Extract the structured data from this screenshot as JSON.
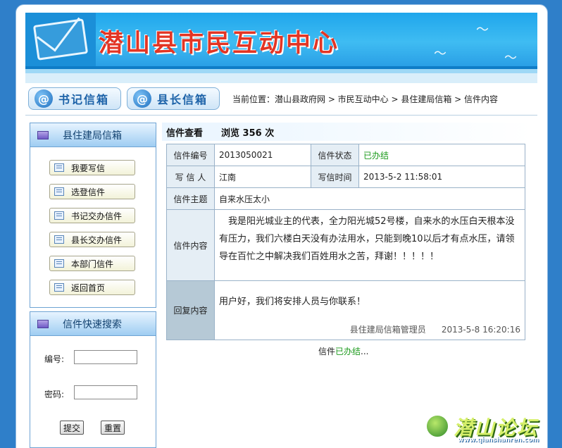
{
  "banner": {
    "title": "潜山县市民互动中心"
  },
  "nav": {
    "tabs": [
      {
        "label": "书记信箱"
      },
      {
        "label": "县长信箱"
      }
    ],
    "breadcrumb": "当前位置：潜山县政府网 > 市民互动中心 > 县住建局信箱 > 信件内容"
  },
  "sidebar": {
    "menu_title": "县住建局信箱",
    "items": [
      {
        "label": "我要写信"
      },
      {
        "label": "选登信件"
      },
      {
        "label": "书记交办信件"
      },
      {
        "label": "县长交办信件"
      },
      {
        "label": "本部门信件"
      },
      {
        "label": "返回首页"
      }
    ],
    "search": {
      "title": "信件快速搜索",
      "number_label": "编号:",
      "password_label": "密码:",
      "number_value": "",
      "password_value": "",
      "submit_label": "提交",
      "reset_label": "重置"
    }
  },
  "letter": {
    "header": "信件查看　　浏览 356 次",
    "number_label": "信件编号",
    "number": "2013050021",
    "status_label": "信件状态",
    "status": "已办结",
    "writer_label": "写 信 人",
    "writer": "江南",
    "time_label": "写信时间",
    "time": "2013-5-2 11:58:01",
    "subject_label": "信件主题",
    "subject": "自来水压太小",
    "content_label": "信件内容",
    "content": "　我是阳光城业主的代表，全力阳光城52号楼，自来水的水压白天根本没有压力，我们六楼白天没有办法用水，只能到晚10以后才有点水压，请领导在百忙之中解决我们百姓用水之苦，拜谢！！！！！",
    "reply_label": "回复内容",
    "reply": "用户好，我们将安排人员与你联系！",
    "reply_signer": "县住建局信箱管理员",
    "reply_time": "2013-5-8 16:20:16",
    "footer_prefix": "信件",
    "footer_status": "已办结",
    "footer_suffix": "..."
  },
  "watermark": {
    "name": "潜山论坛",
    "url": "www.qianshanren.com"
  },
  "colors": {
    "accent": "#1fa6ec",
    "title_red": "#e33524",
    "status_green": "#1c9a1c"
  }
}
